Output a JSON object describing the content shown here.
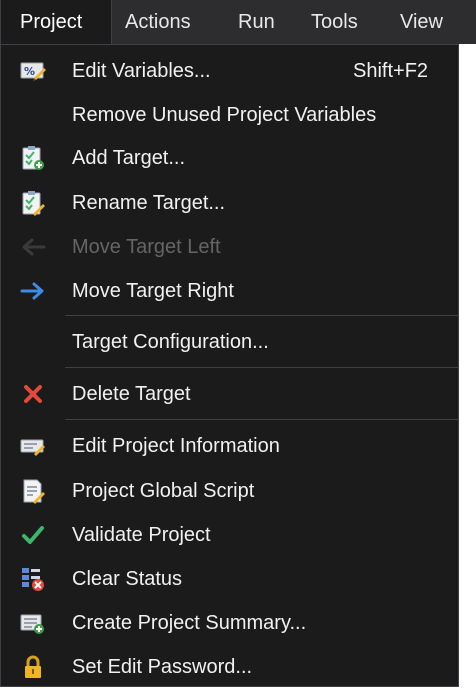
{
  "menubar": {
    "items": [
      {
        "label": "Project"
      },
      {
        "label": "Actions"
      },
      {
        "label": "Run"
      },
      {
        "label": "Tools"
      },
      {
        "label": "View"
      }
    ]
  },
  "menu": {
    "items": [
      {
        "label": "Edit Variables...",
        "shortcut": "Shift+F2",
        "icon": "variables-icon"
      },
      {
        "label": "Remove Unused Project Variables",
        "icon": ""
      },
      {
        "label": "Add Target...",
        "icon": "add-target-icon"
      },
      {
        "label": "Rename Target...",
        "icon": "rename-target-icon"
      },
      {
        "label": "Move Target Left",
        "icon": "arrow-left-icon",
        "disabled": true
      },
      {
        "label": "Move Target Right",
        "icon": "arrow-right-icon"
      },
      {
        "label": "Target Configuration...",
        "icon": ""
      },
      {
        "label": "Delete Target",
        "icon": "delete-icon"
      },
      {
        "label": "Edit Project Information",
        "icon": "edit-info-icon"
      },
      {
        "label": "Project Global Script",
        "icon": "script-icon"
      },
      {
        "label": "Validate Project",
        "icon": "checkmark-icon"
      },
      {
        "label": "Clear Status",
        "icon": "clear-status-icon"
      },
      {
        "label": "Create Project Summary...",
        "icon": "summary-icon"
      },
      {
        "label": "Set Edit Password...",
        "icon": "lock-icon"
      }
    ]
  },
  "colors": {
    "menu_bg": "#1b1b1c",
    "menubar_bg": "#2d2d30",
    "text": "#f1f1f1",
    "disabled_text": "#656565",
    "separator": "#3f3f46",
    "arrow_blue": "#3b8be8",
    "delete_red": "#e5493a",
    "check_green": "#3fb56b"
  }
}
